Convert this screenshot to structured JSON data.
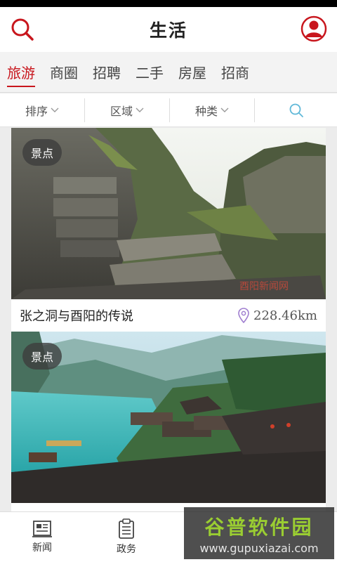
{
  "header": {
    "title": "生活"
  },
  "tabs": [
    {
      "label": "旅游",
      "active": true
    },
    {
      "label": "商圈",
      "active": false
    },
    {
      "label": "招聘",
      "active": false
    },
    {
      "label": "二手",
      "active": false
    },
    {
      "label": "房屋",
      "active": false
    },
    {
      "label": "招商",
      "active": false
    }
  ],
  "filters": {
    "sort": "排序",
    "area": "区域",
    "category": "种类"
  },
  "cards": [
    {
      "badge": "景点",
      "name": "张之洞与酉阳的传说",
      "distance": "228.46km",
      "photo_watermark": "酉阳新闻网"
    },
    {
      "badge": "景点",
      "name": "",
      "distance": ""
    }
  ],
  "bottom_nav": [
    {
      "label": "新闻",
      "icon": "newspaper-icon"
    },
    {
      "label": "政务",
      "icon": "clipboard-icon"
    }
  ],
  "watermark": {
    "title": "谷普软件园",
    "url": "www.gupuxiazai.com"
  },
  "colors": {
    "accent": "#c8161d",
    "filter_search": "#5fb8d8",
    "location_pin": "#a07fd0"
  }
}
